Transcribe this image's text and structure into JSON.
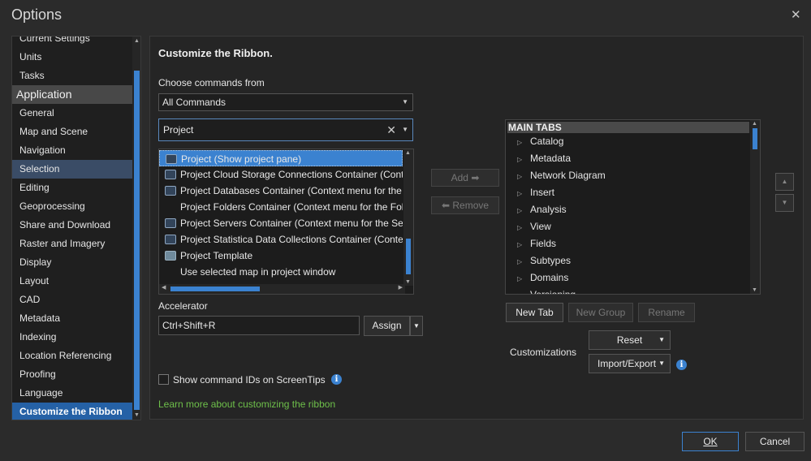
{
  "window": {
    "title": "Options",
    "close_icon": "close-icon"
  },
  "nav": {
    "items": [
      {
        "label": "Current Settings",
        "type": "item"
      },
      {
        "label": "Units",
        "type": "item"
      },
      {
        "label": "Tasks",
        "type": "item"
      },
      {
        "label": "Application",
        "type": "header"
      },
      {
        "label": "General",
        "type": "item"
      },
      {
        "label": "Map and Scene",
        "type": "item"
      },
      {
        "label": "Navigation",
        "type": "item"
      },
      {
        "label": "Selection",
        "type": "selected"
      },
      {
        "label": "Editing",
        "type": "item"
      },
      {
        "label": "Geoprocessing",
        "type": "item"
      },
      {
        "label": "Share and Download",
        "type": "item"
      },
      {
        "label": "Raster and Imagery",
        "type": "item"
      },
      {
        "label": "Display",
        "type": "item"
      },
      {
        "label": "Layout",
        "type": "item"
      },
      {
        "label": "CAD",
        "type": "item"
      },
      {
        "label": "Metadata",
        "type": "item"
      },
      {
        "label": "Indexing",
        "type": "item"
      },
      {
        "label": "Location Referencing",
        "type": "item"
      },
      {
        "label": "Proofing",
        "type": "item"
      },
      {
        "label": "Language",
        "type": "item"
      },
      {
        "label": "Customize the Ribbon",
        "type": "active"
      }
    ]
  },
  "main": {
    "heading": "Customize the Ribbon.",
    "choose_label": "Choose commands from",
    "choose_value": "All Commands",
    "search_value": "Project",
    "commands": [
      {
        "label": "Project (Show project pane)",
        "icon": "project-pane-icon",
        "selected": true
      },
      {
        "label": "Project Cloud Storage Connections Container (Context menu for the Cloud Storage Connections folder)",
        "icon": "cloud-storage-icon"
      },
      {
        "label": "Project Databases Container (Context menu for the Databases folder)",
        "icon": "database-icon"
      },
      {
        "label": "Project Folders Container (Context menu for the Folders folder)",
        "icon": ""
      },
      {
        "label": "Project Servers Container (Context menu for the Servers folder)",
        "icon": "server-icon"
      },
      {
        "label": "Project Statistica Data Collections Container (Context menu)",
        "icon": "statistica-icon"
      },
      {
        "label": "Project Template",
        "icon": "project-template-icon"
      },
      {
        "label": "Use selected map in project window",
        "icon": ""
      }
    ],
    "add_label": "Add",
    "remove_label": "Remove",
    "accelerator_label": "Accelerator",
    "accelerator_value": "Ctrl+Shift+R",
    "assign_label": "Assign",
    "tabs_header": "MAIN TABS",
    "tabs": [
      "Catalog",
      "Metadata",
      "Network Diagram",
      "Insert",
      "Analysis",
      "View",
      "Fields",
      "Subtypes",
      "Domains",
      "Versioning"
    ],
    "new_tab_label": "New Tab",
    "new_group_label": "New Group",
    "rename_label": "Rename",
    "customizations_label": "Customizations",
    "reset_label": "Reset",
    "import_export_label": "Import/Export",
    "screentips_label": "Show command IDs on ScreenTips",
    "learn_more_link": "Learn more about customizing the ribbon"
  },
  "footer": {
    "ok_label": "OK",
    "cancel_label": "Cancel"
  },
  "colors": {
    "accent": "#3b82d0",
    "link": "#6ec04a",
    "background": "#2b2b2b"
  }
}
